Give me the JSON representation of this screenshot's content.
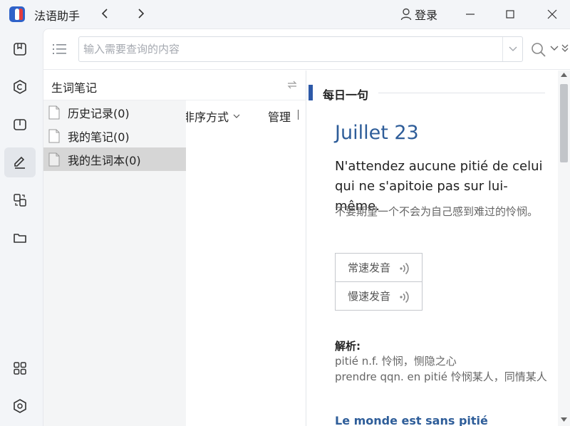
{
  "app": {
    "title": "法语助手",
    "login_label": "登录"
  },
  "rail": {
    "items": [
      {
        "name": "dictionary",
        "icon": "book-icon"
      },
      {
        "name": "conjugation",
        "icon": "c-circle-icon"
      },
      {
        "name": "reading",
        "icon": "open-book-icon"
      },
      {
        "name": "notes",
        "icon": "edit-icon",
        "active": true
      },
      {
        "name": "translate",
        "icon": "translate-icon"
      },
      {
        "name": "files",
        "icon": "folder-icon"
      },
      {
        "name": "apps",
        "icon": "apps-grid-icon"
      },
      {
        "name": "settings",
        "icon": "settings-hex-icon"
      }
    ]
  },
  "search": {
    "placeholder": "输入需要查询的内容",
    "value": ""
  },
  "middle": {
    "title": "生词笔记",
    "sort_label": "非序方式",
    "manage_label": "管理"
  },
  "menu": {
    "items": [
      {
        "label": "历史记录(0)",
        "selected": false
      },
      {
        "label": "我的笔记(0)",
        "selected": false
      },
      {
        "label": "我的生词本(0)",
        "selected": true
      }
    ]
  },
  "daily": {
    "section_title": "每日一句",
    "date": "Juillet 23",
    "sentence": "N'attendez aucune pitié de celui qui ne s'apitoie pas sur lui-même.",
    "translation": "不要期望一个不会为自己感到难过的怜悯。",
    "normal_speed_label": "常速发音",
    "slow_speed_label": "慢速发音",
    "analysis_title": "解析:",
    "analysis_lines": [
      "pitié n.f. 怜悯，恻隐之心",
      "prendre qqn. en pitié 怜悯某人，同情某人"
    ],
    "next_title": "Le monde est sans pitié"
  },
  "colors": {
    "accent": "#2d59a8",
    "date_blue": "#2e5d99"
  }
}
